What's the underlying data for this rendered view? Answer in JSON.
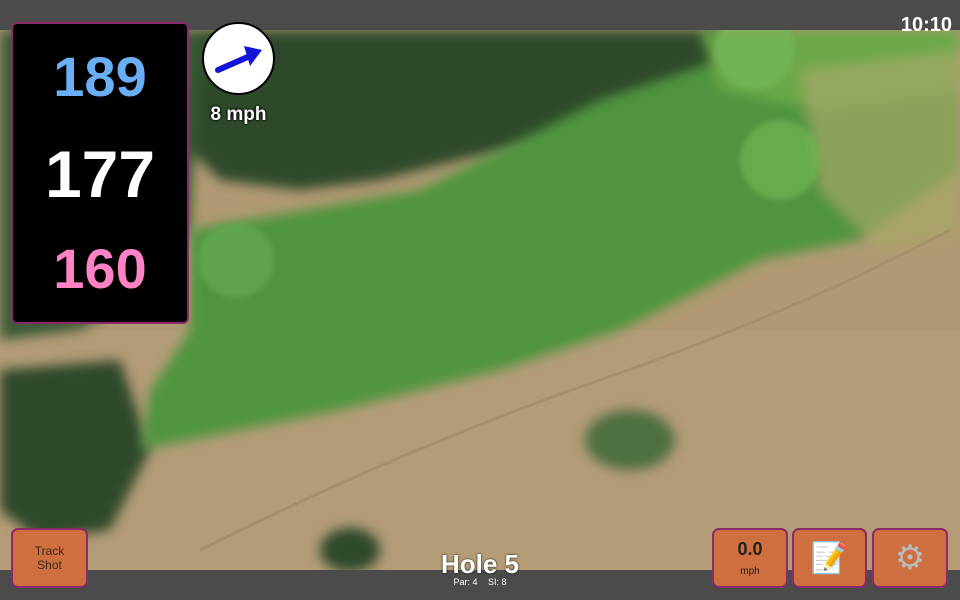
{
  "status": {
    "time": "10:10"
  },
  "distances": {
    "back": "189",
    "middle": "177",
    "front": "160",
    "colors": {
      "back": "#6aaef5",
      "middle": "#ffffff",
      "front": "#ff82c4"
    }
  },
  "wind": {
    "speed_label": "8 mph",
    "icon": "wind-direction-arrow-icon"
  },
  "buttons": {
    "track_shot": "Track\nShot",
    "speed_value": "0.0",
    "speed_unit": "mph",
    "notes_icon": "notepad-icon",
    "settings_icon": "gear-icon"
  },
  "hole": {
    "title": "Hole 5",
    "par": "Par: 4",
    "si": "SI: 8"
  },
  "colors": {
    "accent": "#cf6f3f",
    "border": "#8b2a6a",
    "fairway": "#3f9a3a",
    "rough": "#b39a72"
  }
}
